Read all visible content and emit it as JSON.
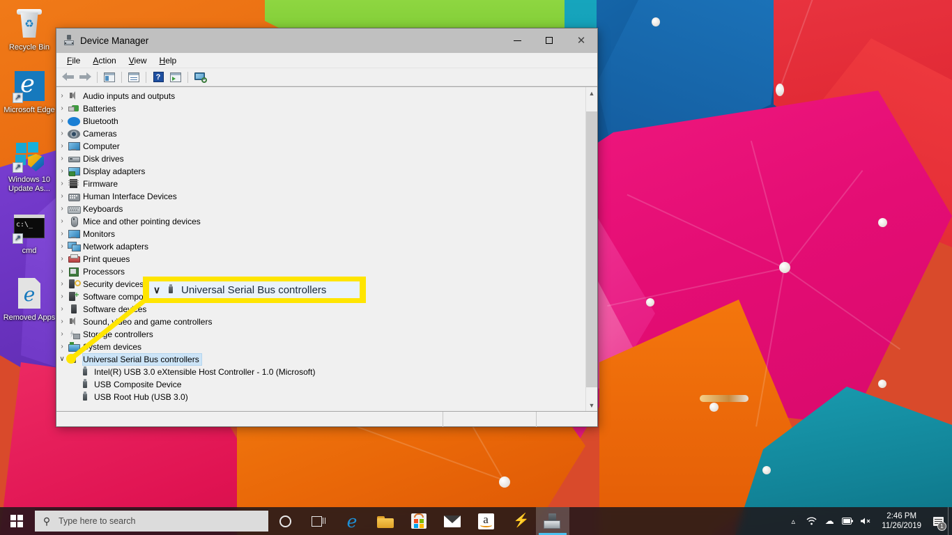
{
  "desktop": {
    "icons": [
      {
        "label": "Recycle Bin",
        "icon": "recycle-bin-icon"
      },
      {
        "label": "Microsoft Edge",
        "icon": "edge-icon"
      },
      {
        "label": "Windows 10 Update As...",
        "icon": "windows-update-assistant-icon"
      },
      {
        "label": "cmd",
        "icon": "command-prompt-icon"
      },
      {
        "label": "Removed Apps",
        "icon": "removed-apps-icon"
      }
    ]
  },
  "window": {
    "title": "Device Manager",
    "icon": "device-manager-icon",
    "controls": {
      "minimize": "—",
      "maximize": "□",
      "close": "✕"
    },
    "menu": [
      {
        "label": "File",
        "accel": "F"
      },
      {
        "label": "Action",
        "accel": "A"
      },
      {
        "label": "View",
        "accel": "V"
      },
      {
        "label": "Help",
        "accel": "H"
      }
    ],
    "toolbar": [
      {
        "name": "back-button",
        "icon": "back-arrow-icon"
      },
      {
        "name": "forward-button",
        "icon": "forward-arrow-icon"
      },
      {
        "name": "show-hide-console-tree-button",
        "icon": "console-tree-icon"
      },
      {
        "name": "properties-button",
        "icon": "properties-icon"
      },
      {
        "name": "help-button",
        "icon": "help-icon",
        "glyph": "?"
      },
      {
        "name": "update-driver-button",
        "icon": "update-driver-icon"
      },
      {
        "name": "scan-for-hardware-changes-button",
        "icon": "scan-hardware-icon"
      }
    ],
    "statusbar": {
      "segment1": "",
      "segment2": "",
      "segment3": ""
    }
  },
  "tree": {
    "nodes": [
      {
        "label": "Audio inputs and outputs",
        "state": "collapsed",
        "icon": "speaker-icon",
        "cls": "ic-speaker"
      },
      {
        "label": "Batteries",
        "state": "collapsed",
        "icon": "battery-icon",
        "cls": "ic-batt"
      },
      {
        "label": "Bluetooth",
        "state": "collapsed",
        "icon": "bluetooth-icon",
        "cls": "ic-bt"
      },
      {
        "label": "Cameras",
        "state": "collapsed",
        "icon": "camera-icon",
        "cls": "ic-cam"
      },
      {
        "label": "Computer",
        "state": "collapsed",
        "icon": "computer-icon",
        "cls": "ic-monitor"
      },
      {
        "label": "Disk drives",
        "state": "collapsed",
        "icon": "disk-drive-icon",
        "cls": "ic-disk"
      },
      {
        "label": "Display adapters",
        "state": "collapsed",
        "icon": "display-adapter-icon",
        "cls": "ic-display"
      },
      {
        "label": "Firmware",
        "state": "collapsed",
        "icon": "firmware-icon",
        "cls": "ic-fw"
      },
      {
        "label": "Human Interface Devices",
        "state": "collapsed",
        "icon": "hid-icon",
        "cls": "ic-hid"
      },
      {
        "label": "Keyboards",
        "state": "collapsed",
        "icon": "keyboard-icon",
        "cls": "ic-kbd"
      },
      {
        "label": "Mice and other pointing devices",
        "state": "collapsed",
        "icon": "mouse-icon",
        "cls": "ic-mouse"
      },
      {
        "label": "Monitors",
        "state": "collapsed",
        "icon": "monitor-icon",
        "cls": "ic-monitor"
      },
      {
        "label": "Network adapters",
        "state": "collapsed",
        "icon": "network-adapter-icon",
        "cls": "ic-net"
      },
      {
        "label": "Print queues",
        "state": "collapsed",
        "icon": "printer-icon",
        "cls": "ic-print"
      },
      {
        "label": "Processors",
        "state": "collapsed",
        "icon": "processor-icon",
        "cls": "ic-proc"
      },
      {
        "label": "Security devices",
        "state": "collapsed",
        "icon": "security-device-icon",
        "cls": "ic-sec"
      },
      {
        "label": "Software components",
        "state": "collapsed",
        "icon": "software-component-icon",
        "cls": "ic-sw"
      },
      {
        "label": "Software devices",
        "state": "collapsed",
        "icon": "software-device-icon",
        "cls": "ic-swd"
      },
      {
        "label": "Sound, video and game controllers",
        "state": "collapsed",
        "icon": "sound-controller-icon",
        "cls": "ic-speaker"
      },
      {
        "label": "Storage controllers",
        "state": "collapsed",
        "icon": "storage-controller-icon",
        "cls": "ic-storage"
      },
      {
        "label": "System devices",
        "state": "collapsed",
        "icon": "system-device-icon",
        "cls": "ic-sys"
      },
      {
        "label": "Universal Serial Bus controllers",
        "state": "expanded",
        "selected": true,
        "icon": "usb-icon",
        "cls": "ic-usb"
      }
    ],
    "children": [
      {
        "label": "Intel(R) USB 3.0 eXtensible Host Controller - 1.0 (Microsoft)",
        "icon": "usb-icon",
        "cls": "ic-usb"
      },
      {
        "label": "USB Composite Device",
        "icon": "usb-icon",
        "cls": "ic-usb"
      },
      {
        "label": "USB Root Hub (USB 3.0)",
        "icon": "usb-icon",
        "cls": "ic-usb"
      }
    ],
    "chevron_collapsed": "›",
    "chevron_expanded": "∨"
  },
  "callout": {
    "label": "Universal Serial Bus controllers",
    "chevron": "∨",
    "icon": "usb-icon",
    "border_color": "#ffe500",
    "inner_color": "#e9f2fb",
    "pointer_color": "#ffe500"
  },
  "taskbar": {
    "start": {
      "name": "start-button",
      "icon": "windows-logo-icon"
    },
    "search": {
      "placeholder": "Type here to search",
      "icon": "search-icon"
    },
    "apps": [
      {
        "name": "cortana-button",
        "icon": "cortana-circle-icon",
        "label": "Cortana"
      },
      {
        "name": "task-view-button",
        "icon": "task-view-icon",
        "label": "Task View"
      },
      {
        "name": "edge-taskbar-button",
        "icon": "edge-icon",
        "label": "Microsoft Edge",
        "glyph": "e"
      },
      {
        "name": "file-explorer-button",
        "icon": "folder-icon",
        "label": "File Explorer"
      },
      {
        "name": "microsoft-store-button",
        "icon": "store-bag-icon",
        "label": "Microsoft Store"
      },
      {
        "name": "mail-button",
        "icon": "envelope-icon",
        "label": "Mail"
      },
      {
        "name": "amazon-button",
        "icon": "amazon-icon",
        "label": "Amazon",
        "glyph": "a"
      },
      {
        "name": "lightning-app-button",
        "icon": "lightning-bolt-icon",
        "label": "",
        "glyph": "⚡"
      },
      {
        "name": "device-manager-taskbar-button",
        "icon": "device-manager-icon",
        "label": "Device Manager",
        "active": true
      }
    ],
    "tray": [
      {
        "name": "show-hidden-icons-button",
        "icon": "chevron-up-icon",
        "glyph": "⌃"
      },
      {
        "name": "network-button",
        "icon": "wifi-icon"
      },
      {
        "name": "onedrive-button",
        "icon": "cloud-icon",
        "glyph": "☁"
      },
      {
        "name": "battery-button",
        "icon": "battery-icon"
      },
      {
        "name": "volume-button",
        "icon": "speaker-muted-icon"
      }
    ],
    "clock": {
      "time": "2:46 PM",
      "date": "11/26/2019"
    },
    "notifications": {
      "icon": "notification-center-icon",
      "count": "1"
    }
  },
  "colors": {
    "accent": "#4cc2f1",
    "highlight": "#cce4f7",
    "callout_yellow": "#ffe500",
    "window_chrome": "#f0f0f0",
    "titlebar": "#c0c0c0"
  }
}
